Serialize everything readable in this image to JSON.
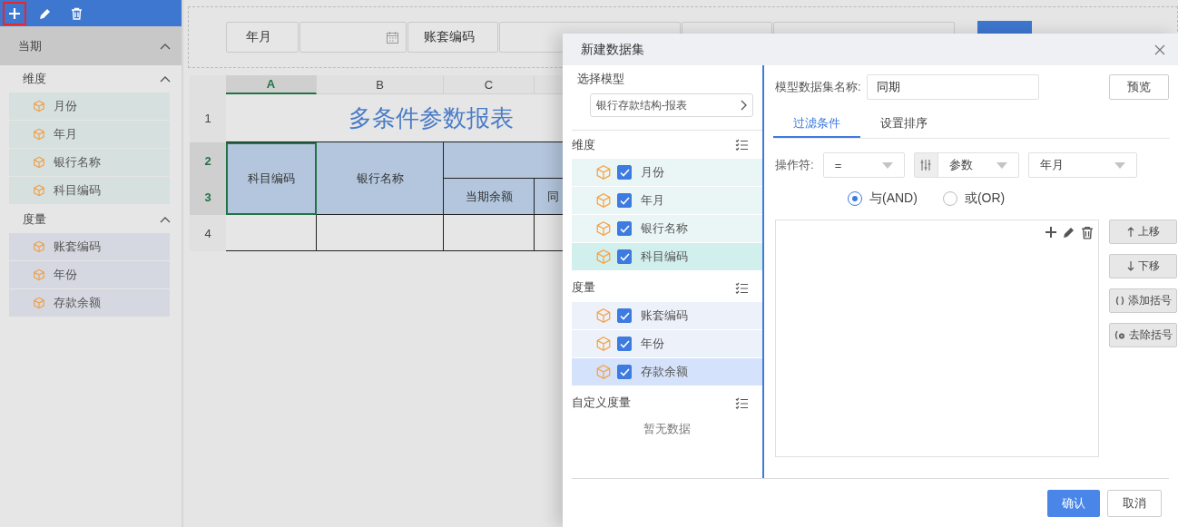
{
  "sidebar": {
    "toolbar": [
      {
        "kind": "add",
        "highlighted": true
      },
      {
        "kind": "edit",
        "highlighted": false
      },
      {
        "kind": "delete",
        "highlighted": false
      }
    ],
    "dataset": {
      "title": "当期",
      "expanded": true,
      "groups": [
        {
          "title": "维度",
          "kind": "dimension",
          "expanded": true,
          "items": [
            "月份",
            "年月",
            "银行名称",
            "科目编码"
          ]
        },
        {
          "title": "度量",
          "kind": "measure",
          "expanded": true,
          "items": [
            "账套编码",
            "年份",
            "存款余额"
          ]
        }
      ]
    }
  },
  "params": [
    {
      "kind": "label",
      "text": "年月"
    },
    {
      "kind": "date"
    },
    {
      "kind": "label",
      "text": "账套编码"
    },
    {
      "kind": "input"
    },
    {
      "kind": "label"
    },
    {
      "kind": "input"
    },
    {
      "kind": "button"
    }
  ],
  "sheet": {
    "columns": [
      {
        "label": "A",
        "selected": true
      },
      {
        "label": "B",
        "selected": false
      },
      {
        "label": "C",
        "selected": false
      }
    ],
    "rows": [
      {
        "label": "1",
        "selected": false
      },
      {
        "label": "2",
        "selected": true
      },
      {
        "label": "3",
        "selected": true
      },
      {
        "label": "4",
        "selected": false
      }
    ],
    "title": "多条件参数报表",
    "merged_headers": [
      {
        "text": "科目编码",
        "selected": true
      },
      {
        "text": "银行名称",
        "selected": false
      }
    ],
    "sub_headers": [
      "当期余额",
      "同"
    ]
  },
  "dialog": {
    "title": "新建数据集",
    "model": {
      "label": "选择模型",
      "value": "银行存款结构-报表"
    },
    "groups": [
      {
        "title": "维度",
        "kind": "dimension",
        "items": [
          {
            "label": "月份",
            "checked": true,
            "selected": false
          },
          {
            "label": "年月",
            "checked": true,
            "selected": false
          },
          {
            "label": "银行名称",
            "checked": true,
            "selected": false
          },
          {
            "label": "科目编码",
            "checked": true,
            "selected": true
          }
        ]
      },
      {
        "title": "度量",
        "kind": "measure",
        "items": [
          {
            "label": "账套编码",
            "checked": true,
            "selected": false
          },
          {
            "label": "年份",
            "checked": true,
            "selected": false
          },
          {
            "label": "存款余额",
            "checked": true,
            "selected": true
          }
        ]
      },
      {
        "title": "自定义度量",
        "empty": "暂无数据"
      }
    ],
    "name_label": "模型数据集名称:",
    "name_value": "同期",
    "preview": "预览",
    "tabs": [
      {
        "label": "过滤条件",
        "selected": true
      },
      {
        "label": "设置排序",
        "selected": false
      }
    ],
    "operator_label": "操作符:",
    "operator": "=",
    "param_type": "参数",
    "param_value": "年月",
    "logic": [
      {
        "label": "与(AND)",
        "selected": true
      },
      {
        "label": "或(OR)",
        "selected": false
      }
    ],
    "side_buttons": [
      {
        "kind": "up",
        "label": "上移"
      },
      {
        "kind": "down",
        "label": "下移"
      },
      {
        "kind": "add-bracket",
        "label": "添加括号"
      },
      {
        "kind": "remove-bracket",
        "label": "去除括号"
      }
    ],
    "footer": [
      {
        "kind": "primary",
        "label": "确认"
      },
      {
        "kind": "default",
        "label": "取消"
      }
    ]
  }
}
